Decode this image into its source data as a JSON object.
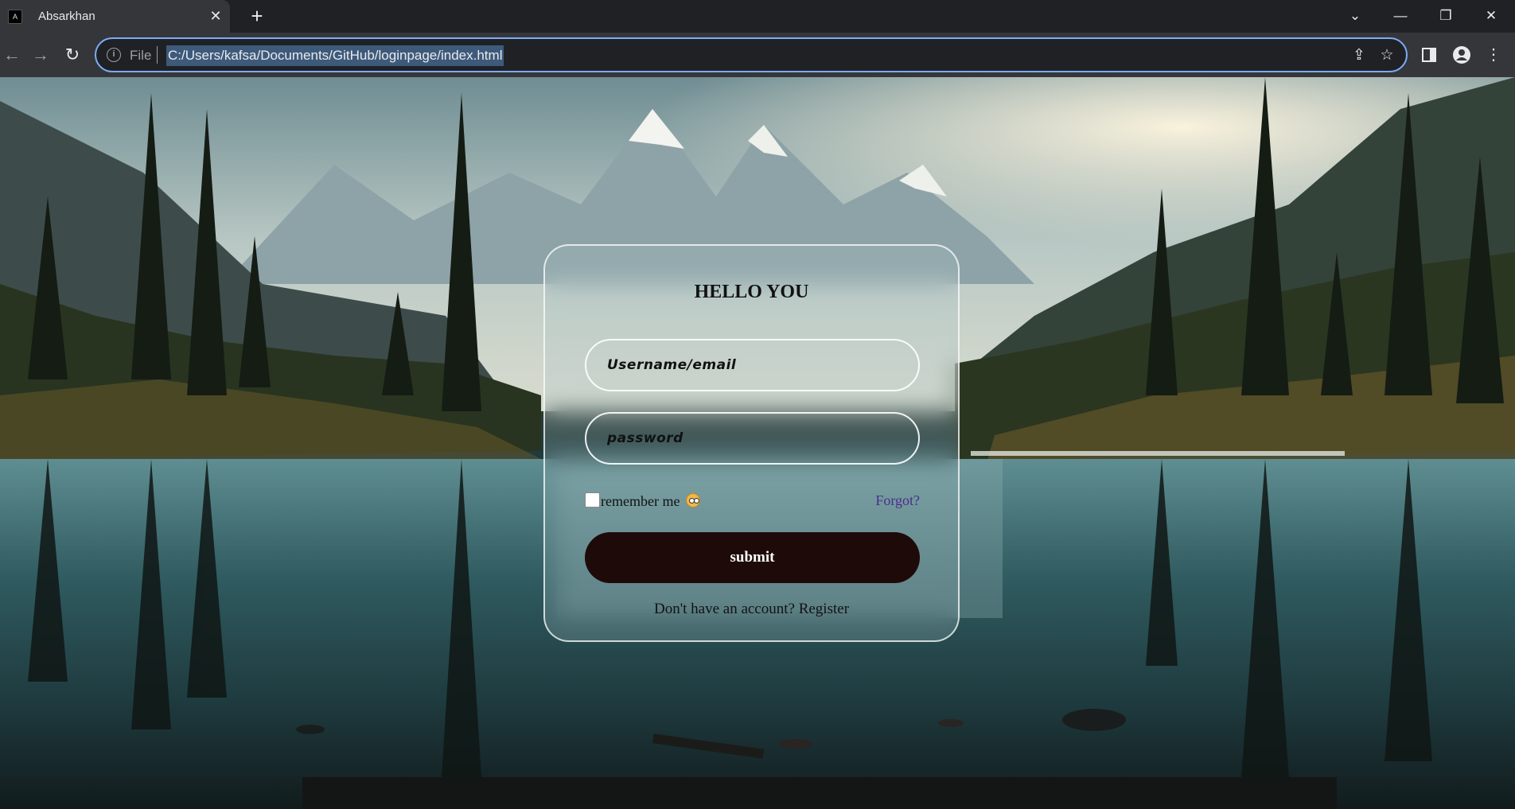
{
  "browser": {
    "tab_title": "Absarkhan",
    "tab_close": "✕",
    "new_tab": "+",
    "controls": {
      "tab_search": "⌄",
      "minimize": "—",
      "restore": "❐",
      "close": "✕"
    },
    "nav": {
      "back": "←",
      "forward": "→",
      "reload": "↻"
    },
    "omnibox": {
      "scheme_label": "File",
      "url": "C:/Users/kafsa/Documents/GitHub/loginpage/index.html"
    },
    "icons": [
      "info-icon",
      "share-icon",
      "star-icon",
      "side-panel-icon",
      "profile-icon",
      "menu-icon"
    ]
  },
  "login": {
    "title": "HELLO YOU",
    "username_placeholder": "Username/email",
    "password_placeholder": "password",
    "remember_label": "remember me",
    "forgot_label": "Forgot?",
    "submit_label": "submit",
    "register_prompt": "Don't have an account?",
    "register_link": "Register"
  },
  "colors": {
    "accent_focus": "#7cacf8",
    "submit_bg": "#1e0b09",
    "forgot_link": "#4b2c8c"
  }
}
